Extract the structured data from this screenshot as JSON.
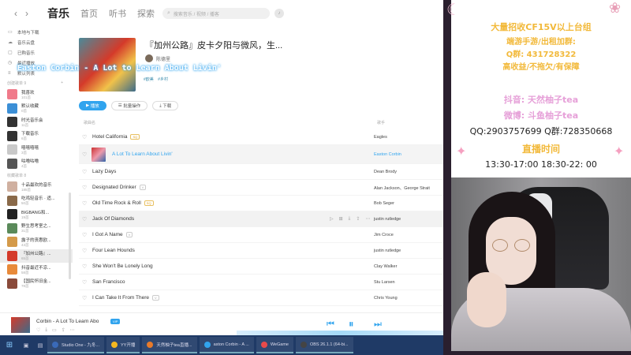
{
  "app": {
    "nav": {
      "back": "‹",
      "forward": "›",
      "tabs": [
        "音乐",
        "首页",
        "听书",
        "探索"
      ],
      "search_placeholder": "搜索音乐 / 视频 / 播客"
    },
    "sidebar": {
      "top_items": [
        "本地与下载",
        "音乐云盘",
        "已购音乐",
        "最近播放",
        "默认列表"
      ],
      "created_heading": "创建歌单 9",
      "created": [
        {
          "name": "我喜欢",
          "count": "101首"
        },
        {
          "name": "默认收藏",
          "count": "0首"
        },
        {
          "name": "时光音乐会",
          "count": "11首"
        },
        {
          "name": "下载音乐",
          "count": "6首"
        },
        {
          "name": "嘻嘻嘻嘻",
          "count": "3首"
        },
        {
          "name": "咕噜咕噜",
          "count": "4首"
        }
      ],
      "collected_heading": "收藏歌单 8",
      "collected": [
        {
          "name": "十品最欢的音乐",
          "count": "185首"
        },
        {
          "name": "吃鸡轻音乐 · 适...",
          "count": "50首"
        },
        {
          "name": "BIGBANG和...",
          "count": "19首"
        },
        {
          "name": "野生思考室之...",
          "count": "31首"
        },
        {
          "name": "露子的丧惠欧...",
          "count": "43首"
        },
        {
          "name": "『加州公路』...",
          "count": "65首"
        },
        {
          "name": "抖音最近不凉...",
          "count": "58首"
        },
        {
          "name": "【国民怀旧金...",
          "count": "78首"
        }
      ]
    },
    "album": {
      "title": "『加州公路』皮卡夕阳与微风，生...",
      "creator": "陈德里",
      "overlay": "Easton Corbin - A Lot to Learn About Livin'",
      "tags": [
        "#欧美",
        "#乡村"
      ],
      "buttons": [
        "播放",
        "批量操作",
        "下载"
      ]
    },
    "list_headers": {
      "song": "歌曲名",
      "singer": "歌手"
    },
    "tracks": [
      {
        "name": "Hotel California",
        "badge": "SQ",
        "singer": "Eagles"
      },
      {
        "name": "A Lot To Learn About Livin'",
        "badge": "",
        "singer": "Easton Corbin"
      },
      {
        "name": "Lazy Days",
        "badge": "",
        "singer": "Dean Brody"
      },
      {
        "name": "Designated Drinker",
        "badge": "V",
        "singer": "Alan Jackson、George Strait"
      },
      {
        "name": "Old Time Rock & Roll",
        "badge": "SQ",
        "singer": "Bob Seger"
      },
      {
        "name": "Jack Of Diamonds",
        "badge": "",
        "singer": "justin rutledge"
      },
      {
        "name": "I Got A Name",
        "badge": "V",
        "singer": "Jim Croce"
      },
      {
        "name": "Four Lean Hounds",
        "badge": "",
        "singer": "justin rutledge"
      },
      {
        "name": "She Won't Be Lonely Long",
        "badge": "",
        "singer": "Clay Walker"
      },
      {
        "name": "San Francisco",
        "badge": "",
        "singer": "Stu Larsen"
      },
      {
        "name": "I Can Take It From There",
        "badge": "V",
        "singer": "Chris Young"
      }
    ],
    "player": {
      "now_playing": "Corbin - A Lot To Learn Abo",
      "badge": "VIP",
      "prev": "⏮",
      "pause": "⏸",
      "next": "⏭"
    }
  },
  "taskbar": {
    "items": [
      {
        "label": "Studio One - 九冬...",
        "color": "#3a6ab8"
      },
      {
        "label": "YY开播",
        "color": "#f5b820"
      },
      {
        "label": "天然柚子tea直播...",
        "color": "#e87a2a"
      },
      {
        "label": "aston Corbin - A ...",
        "color": "#31a4ee"
      },
      {
        "label": "WeGame",
        "color": "#e84a4a"
      },
      {
        "label": "OBS 26.1.1 (64-bi...",
        "color": "#444444"
      }
    ]
  },
  "promo": {
    "line1": "大量招收CF15V以上台组",
    "line2": "端游手游/出租加群:",
    "line3": "Q群: 431728322",
    "line4": "高收益/不拖欠/有保障",
    "line5": "抖音: 天然柚子tea",
    "line6": "微博: 斗鱼柚子tea",
    "line7": "QQ:2903757699 Q群:728350668",
    "line8": "直播时间",
    "line9": "13:30-17:00  18:30-22: 00"
  }
}
